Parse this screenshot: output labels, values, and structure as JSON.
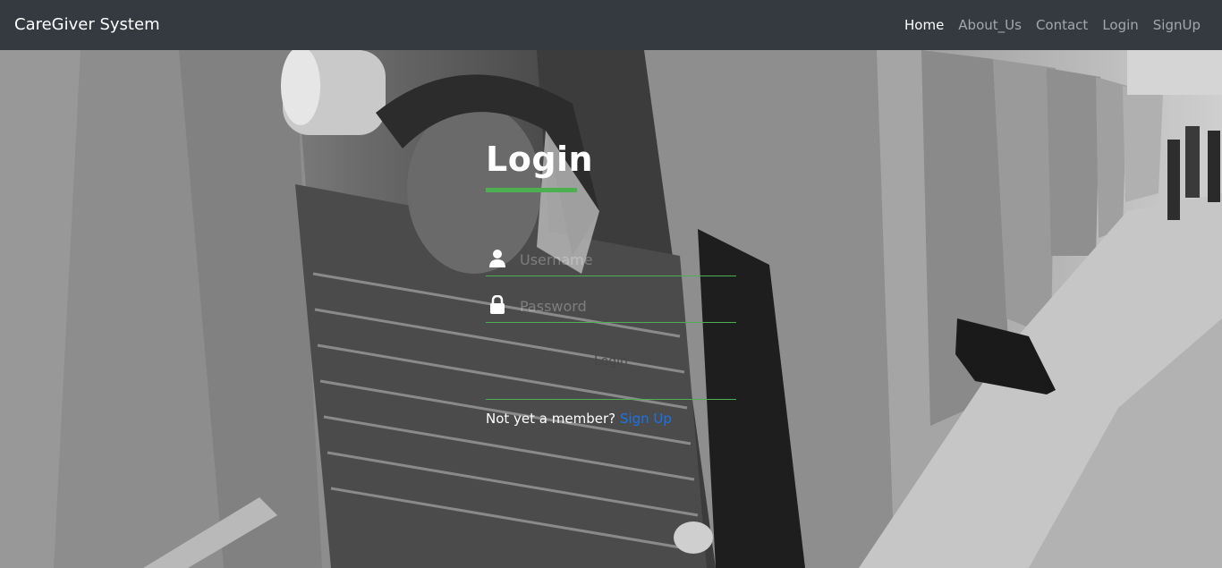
{
  "navbar": {
    "brand": "CareGiver System",
    "links": [
      {
        "label": "Home",
        "active": true
      },
      {
        "label": "About_Us",
        "active": false
      },
      {
        "label": "Contact",
        "active": false
      },
      {
        "label": "Login",
        "active": false
      },
      {
        "label": "SignUp",
        "active": false
      }
    ]
  },
  "login": {
    "title": "Login",
    "username_placeholder": "Username",
    "password_placeholder": "Password",
    "button_label": "Login",
    "signup_prompt": "Not yet a member?",
    "signup_link": "Sign Up"
  },
  "icons": {
    "username": "user-icon",
    "password": "lock-icon"
  },
  "colors": {
    "navbar_bg": "#343a40",
    "accent_green": "#4caf50",
    "link_blue": "#1a73e8"
  }
}
